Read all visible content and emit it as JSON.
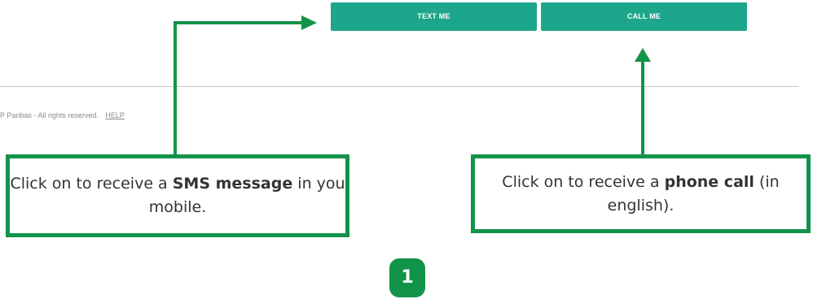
{
  "buttons": {
    "text_me": "TEXT ME",
    "call_me": "CALL ME"
  },
  "footer": {
    "copyright": "P Paribas - All rights reserved.",
    "help": "HELP"
  },
  "callouts": {
    "sms": {
      "prefix": "Click on to receive a ",
      "bold": "SMS message",
      "suffix": " in you mobile."
    },
    "call": {
      "prefix": "Click on to receive a ",
      "bold": "phone call",
      "suffix": " (in english)."
    }
  },
  "step": "1",
  "colors": {
    "button_teal": "#1da68b",
    "annotation_green": "#12934a",
    "divider_gray": "#c8c8c8",
    "footer_text_gray": "#8a8a8a"
  }
}
